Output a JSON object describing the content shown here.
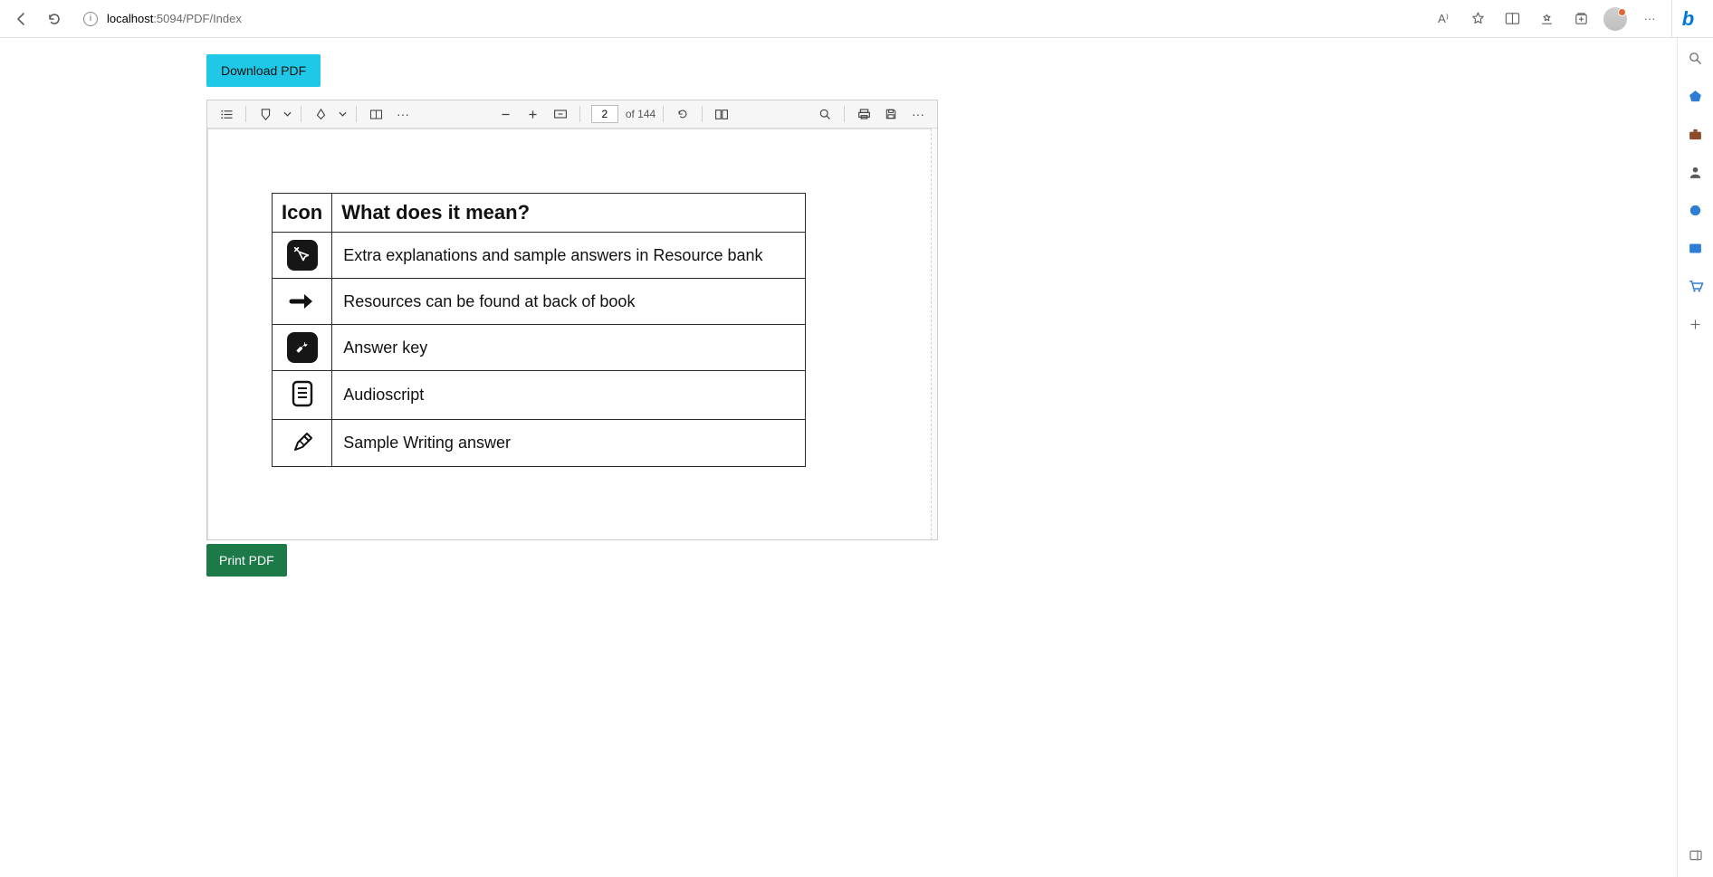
{
  "browser": {
    "url_prefix": "localhost",
    "url_rest": ":5094/PDF/Index",
    "read_aloud_label": "A⁾",
    "more_label": "···"
  },
  "buttons": {
    "download": "Download PDF",
    "print": "Print PDF"
  },
  "pdf_toolbar": {
    "current_page": "2",
    "total_pages": "of 144",
    "more_label": "···"
  },
  "table": {
    "header_icon": "Icon",
    "header_meaning": "What does it mean?",
    "rows": [
      {
        "icon": "magic-cursor",
        "text": "Extra explanations and sample answers in Resource bank"
      },
      {
        "icon": "arrow-right",
        "text": "Resources can be found at back of book"
      },
      {
        "icon": "wrench",
        "text": "Answer key"
      },
      {
        "icon": "document-lines",
        "text": "Audioscript"
      },
      {
        "icon": "pencil",
        "text": "Sample Writing answer"
      }
    ]
  }
}
